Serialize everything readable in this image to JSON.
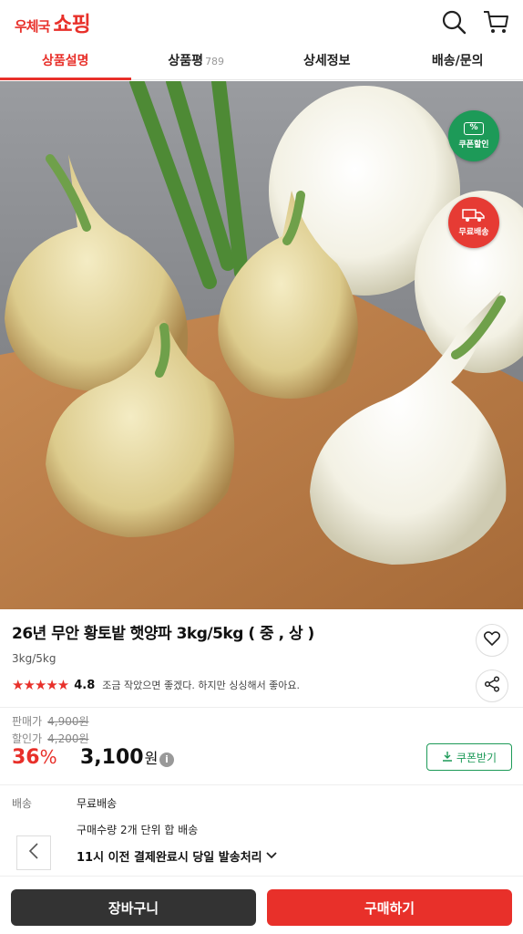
{
  "header": {
    "logo_small": "우체국",
    "logo_big": "쇼핑",
    "icons": [
      "search-icon",
      "cart-icon"
    ]
  },
  "tabs": [
    {
      "label": "상품설명",
      "count": ""
    },
    {
      "label": "상품평",
      "count": "789"
    },
    {
      "label": "상세정보",
      "count": ""
    },
    {
      "label": "배송/문의",
      "count": ""
    }
  ],
  "badges": {
    "coupon_label": "쿠폰할인",
    "coupon_symbol": "%",
    "shipping_label": "무료배송"
  },
  "product": {
    "title": "26년 무안 황토밭 햇양파 3kg/5kg ( 중 , 상 )",
    "option": "3kg/5kg",
    "stars": "★★★★★",
    "rating": "4.8",
    "review_snippet": "조금 작았으면 좋겠다. 하지만 싱싱해서 좋아요."
  },
  "price": {
    "sale_label": "판매가",
    "sale_price": "4,900원",
    "discount_label": "할인가",
    "discount_price": "4,200원",
    "discount_percent": "36",
    "percent_sign": "%",
    "final_price": "3,100",
    "won": "원",
    "info_symbol": "i",
    "coupon_button": "쿠폰받기"
  },
  "shipping": {
    "label": "배송",
    "value": "무료배송",
    "note": "구매수량 2개 단위 합 배송",
    "dispatch": "11시 이전 결제완료시 당일 발송처리"
  },
  "actions": {
    "cart": "장바구니",
    "buy": "구매하기"
  },
  "colors": {
    "accent": "#e8302a",
    "green": "#1d9a58",
    "dark_button": "#333333"
  }
}
